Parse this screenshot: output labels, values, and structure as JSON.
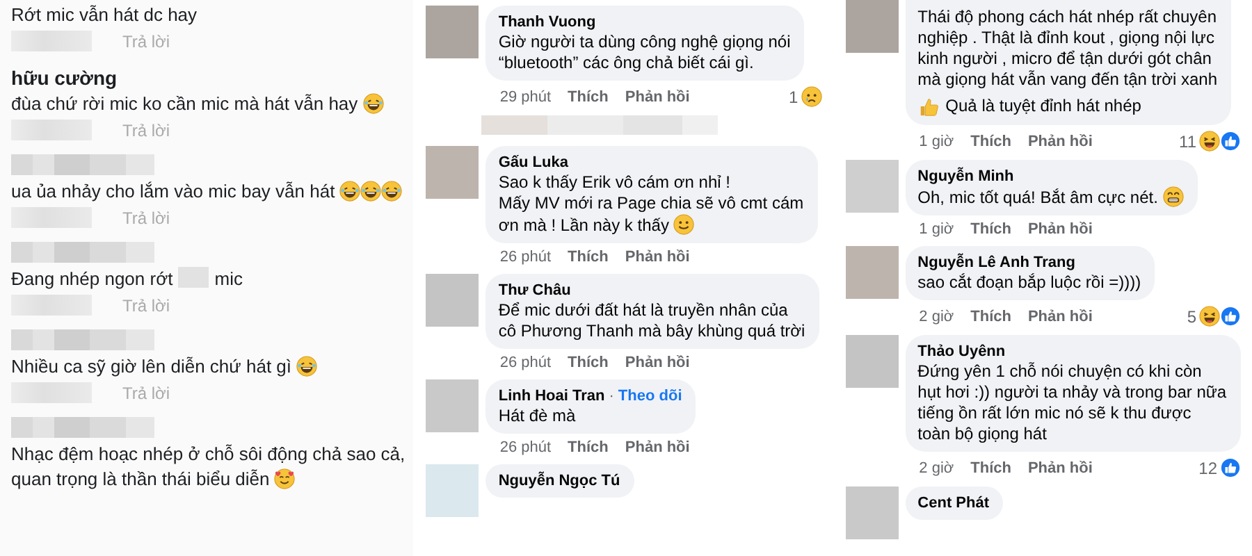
{
  "left_thread": [
    {
      "kind": "cut",
      "text": "Rớt mic vẫn hát dc hay",
      "reply": "Trả lời"
    },
    {
      "kind": "named",
      "author": "hữu cường",
      "text": "đùa chứ rời mic ko cần mic mà hát vẫn hay",
      "emojis": [
        {
          "kind": "laugh"
        }
      ],
      "reply": "Trả lời"
    },
    {
      "kind": "hidden",
      "text": "ua ủa nhảy cho lắm vào mic bay vẫn hát",
      "emojis": [
        {
          "kind": "laugh"
        },
        {
          "kind": "laugh"
        },
        {
          "kind": "laugh"
        }
      ],
      "reply": "Trả lời"
    },
    {
      "kind": "hidden",
      "text_parts": [
        "Đang nhép ngon rớt",
        "mic"
      ],
      "reply": "Trả lời"
    },
    {
      "kind": "hidden",
      "text": "Nhiều ca sỹ giờ lên diễn chứ hát gì",
      "emojis": [
        {
          "kind": "laugh"
        }
      ],
      "reply": "Trả lời"
    },
    {
      "kind": "hidden",
      "text": "Nhạc đệm hoạc nhép ở chỗ sôi động chả sao cả,\nquan trọng là thần thái biểu diễn",
      "emojis": [
        {
          "kind": "love"
        }
      ]
    }
  ],
  "middle_thread": [
    {
      "kind": "named",
      "author": "Thanh Vuong",
      "text": "Giờ người ta dùng công nghệ giọng nói\n“bluetooth” các ông chả biết cái gì.",
      "time": "29 phút",
      "like": "Thích",
      "reply": "Phản hồi",
      "reactions": {
        "count": "1",
        "icons": [
          {
            "kind": "cry"
          }
        ]
      }
    },
    {
      "kind": "blurred"
    },
    {
      "kind": "named",
      "author": "Gấu Luka",
      "text": "Sao k thấy Erik vô cám ơn nhỉ !\nMấy MV mới ra Page chia sẽ vô cmt cám\nơn mà ! Lần này k thấy",
      "emojis": [
        {
          "kind": "smile"
        }
      ],
      "time": "26 phút",
      "like": "Thích",
      "reply": "Phản hồi"
    },
    {
      "kind": "named",
      "author": "Thư Châu",
      "text": "Để mic dưới đất hát là truyền nhân của\ncô Phương Thanh mà bây khùng quá trời",
      "time": "26 phút",
      "like": "Thích",
      "reply": "Phản hồi"
    },
    {
      "kind": "named",
      "author": "Linh Hoai Tran",
      "separator": "·",
      "follow": "Theo dõi",
      "text": "Hát đè mà",
      "time": "26 phút",
      "like": "Thích",
      "reply": "Phản hồi"
    },
    {
      "kind": "cut_bottom",
      "author": "Nguyễn Ngọc Tú"
    }
  ],
  "right_thread": [
    {
      "kind": "cut",
      "text": "Thái độ phong cách hát nhép rất chuyên\nnghiệp . Thật là đỉnh kout , giọng nội lực\nkinh người , micro để tận dưới gót chân\nmà giọng hát vẫn vang đến tận trời xanh",
      "extra_line": "Quả là tuyệt đỉnh hát nhép",
      "extra_emojis": [
        {
          "kind": "thumbs"
        }
      ],
      "time": "1 giờ",
      "like": "Thích",
      "reply": "Phản hồi",
      "reactions": {
        "count": "11",
        "icons": [
          {
            "kind": "haha"
          },
          {
            "kind": "like"
          }
        ]
      }
    },
    {
      "kind": "named",
      "author": "Nguyễn Minh",
      "text": "Oh, mic tốt quá! Bắt âm cực nét.",
      "emojis": [
        {
          "kind": "grin"
        }
      ],
      "time": "1 giờ",
      "like": "Thích",
      "reply": "Phản hồi"
    },
    {
      "kind": "named",
      "author": "Nguyễn Lê Anh Trang",
      "text": "sao cắt đoạn bắp luộc rồi =))))",
      "time": "2 giờ",
      "like": "Thích",
      "reply": "Phản hồi",
      "reactions": {
        "count": "5",
        "icons": [
          {
            "kind": "haha"
          },
          {
            "kind": "like"
          }
        ]
      }
    },
    {
      "kind": "named",
      "author": "Thảo Uyênn",
      "text": "Đứng yên 1 chỗ nói chuyện có khi còn\nhụt hơi :)) người ta nhảy và trong bar nữa\ntiếng ồn rất lớn mic nó sẽ k thu được\ntoàn bộ giọng hát",
      "time": "2 giờ",
      "like": "Thích",
      "reply": "Phản hồi",
      "reactions": {
        "count": "12",
        "icons": [
          {
            "kind": "like"
          }
        ]
      }
    },
    {
      "kind": "cut_bottom",
      "author": "Cent Phát"
    }
  ]
}
